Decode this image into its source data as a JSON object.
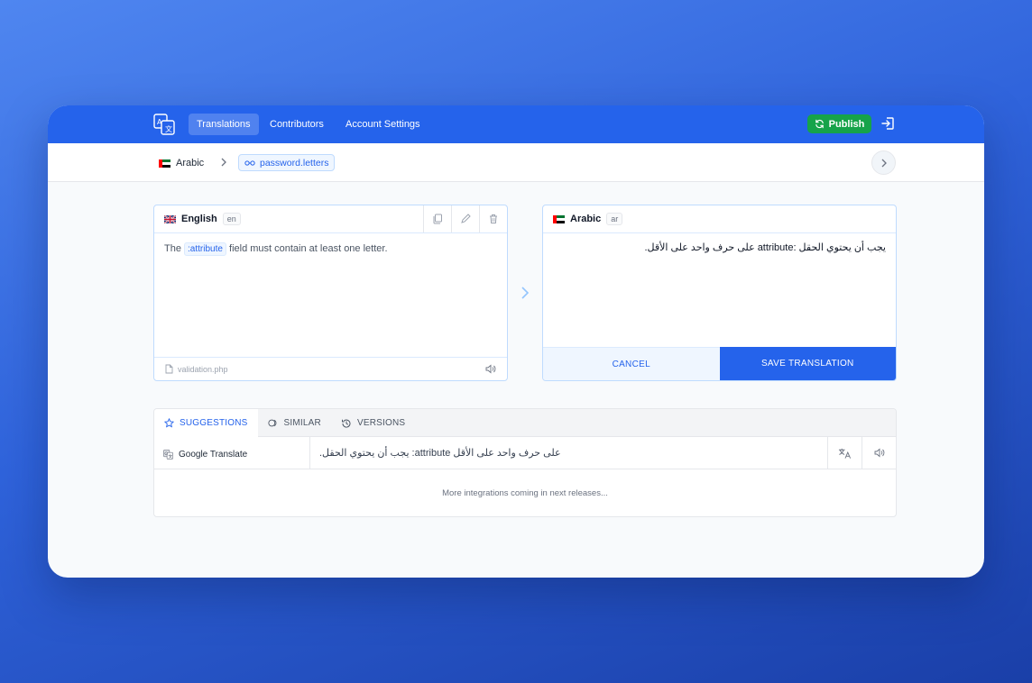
{
  "nav": {
    "items": [
      {
        "label": "Translations",
        "active": true
      },
      {
        "label": "Contributors",
        "active": false
      },
      {
        "label": "Account Settings",
        "active": false
      }
    ],
    "publish_label": "Publish"
  },
  "breadcrumb": {
    "language": "Arabic",
    "key": "password.letters"
  },
  "source": {
    "language": "English",
    "code": "en",
    "text_before": "The",
    "placeholder": ":attribute",
    "text_after": "field must contain at least one letter.",
    "file": "validation.php"
  },
  "target": {
    "language": "Arabic",
    "code": "ar",
    "text": "يجب أن يحتوي الحقل :attribute على حرف واحد على الأقل.",
    "cancel_label": "CANCEL",
    "save_label": "SAVE TRANSLATION"
  },
  "suggestions": {
    "tabs": [
      {
        "label": "SUGGESTIONS",
        "active": true
      },
      {
        "label": "SIMILAR",
        "active": false
      },
      {
        "label": "VERSIONS",
        "active": false
      }
    ],
    "rows": [
      {
        "source": "Google Translate",
        "text": "على حرف واحد على الأقل attribute: يجب أن يحتوي الحقل."
      }
    ],
    "more_text": "More integrations coming in next releases..."
  },
  "colors": {
    "primary": "#2563eb",
    "publish": "#16a34a"
  }
}
